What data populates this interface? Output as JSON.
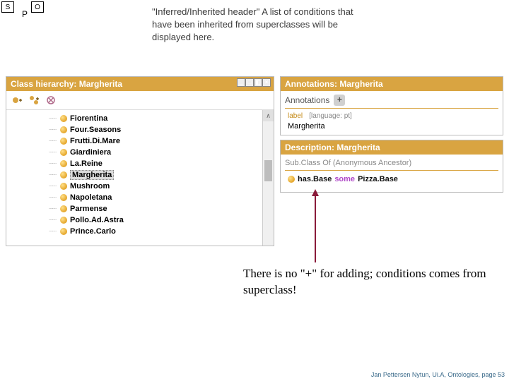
{
  "marks": {
    "s": "S",
    "o": "O",
    "p": "P"
  },
  "top_text": "\"Inferred/Inherited header\" A list of conditions that have been inherited from superclasses will be displayed here.",
  "class_hierarchy": {
    "title": "Class hierarchy: Margherita",
    "classes": [
      "Fiorentina",
      "Four.Seasons",
      "Frutti.Di.Mare",
      "Giardiniera",
      "La.Reine",
      "Margherita",
      "Mushroom",
      "Napoletana",
      "Parmense",
      "Pollo.Ad.Astra",
      "Prince.Carlo"
    ],
    "selected": "Margherita"
  },
  "annotations": {
    "title": "Annotations: Margherita",
    "subhead": "Annotations",
    "label_key": "label",
    "label_lang": "[language: pt]",
    "label_value": "Margherita"
  },
  "description": {
    "title": "Description: Margherita",
    "sub": "Sub.Class Of (Anonymous Ancestor)",
    "axiom": {
      "prop": "has.Base",
      "kw": "some",
      "cls": "Pizza.Base"
    }
  },
  "callout": "There is no \"+\" for adding; conditions comes from superclass!",
  "footer": "Jan Pettersen Nytun, Ui.A, Ontologies, page 53"
}
